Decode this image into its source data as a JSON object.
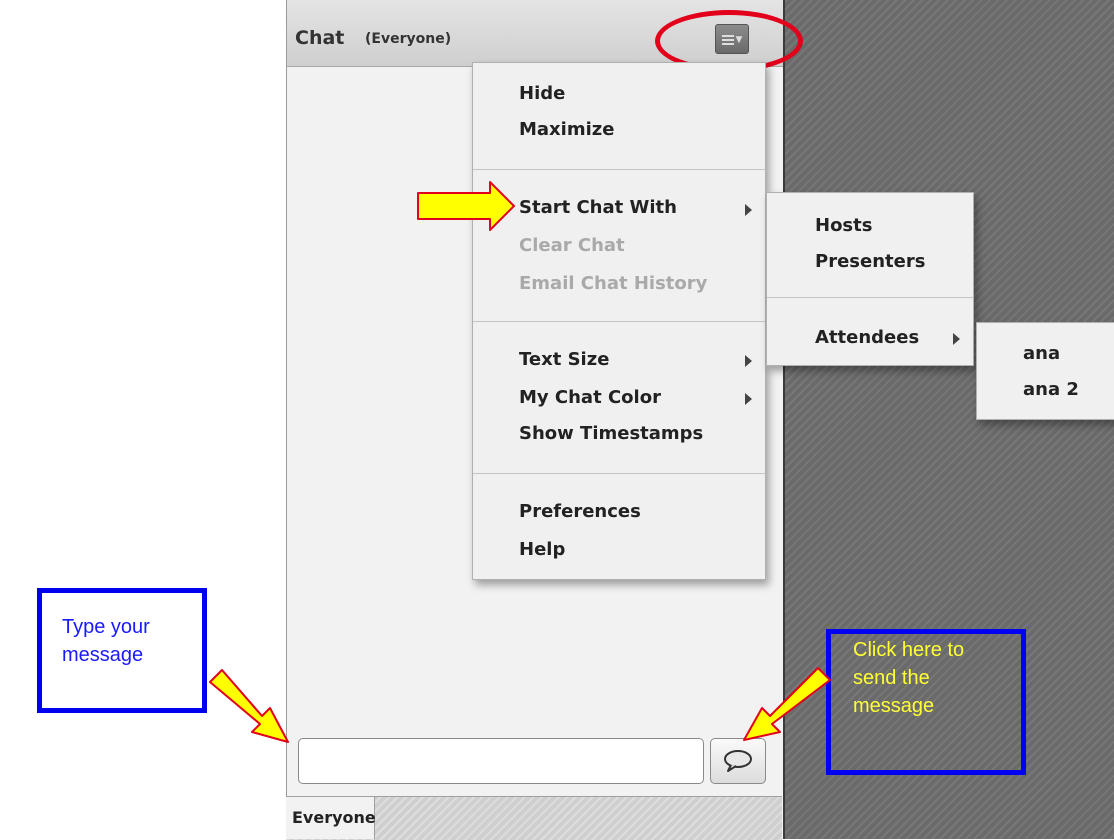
{
  "pod": {
    "title": "Chat",
    "scope": "(Everyone)"
  },
  "main_menu": {
    "items": [
      {
        "label": "Hide",
        "enabled": true
      },
      {
        "label": "Maximize",
        "enabled": true
      },
      {
        "label": "Start Chat With",
        "enabled": true,
        "submenu": true
      },
      {
        "label": "Clear Chat",
        "enabled": false
      },
      {
        "label": "Email Chat History",
        "enabled": false
      },
      {
        "label": "Text Size",
        "enabled": true,
        "submenu": true
      },
      {
        "label": "My Chat Color",
        "enabled": true,
        "submenu": true
      },
      {
        "label": "Show Timestamps",
        "enabled": true
      },
      {
        "label": "Preferences",
        "enabled": true
      },
      {
        "label": "Help",
        "enabled": true
      }
    ]
  },
  "start_chat_submenu": {
    "items": [
      {
        "label": "Hosts"
      },
      {
        "label": "Presenters"
      },
      {
        "label": "Attendees",
        "submenu": true
      }
    ]
  },
  "attendees_submenu": {
    "items": [
      {
        "label": "ana"
      },
      {
        "label": "ana 2"
      }
    ]
  },
  "composer": {
    "input_value": "",
    "send_icon": "speech-bubble-icon"
  },
  "tabs": {
    "active": "Everyone"
  },
  "annotations": {
    "type_message": "Type your message",
    "send_message_lines": [
      "Click  here to",
      "send the",
      "message"
    ]
  },
  "colors": {
    "annotation_border": "#0000f0",
    "highlight_ellipse": "#e2001a",
    "arrow_fill": "#ffff00",
    "arrow_stroke": "#e2001a"
  }
}
